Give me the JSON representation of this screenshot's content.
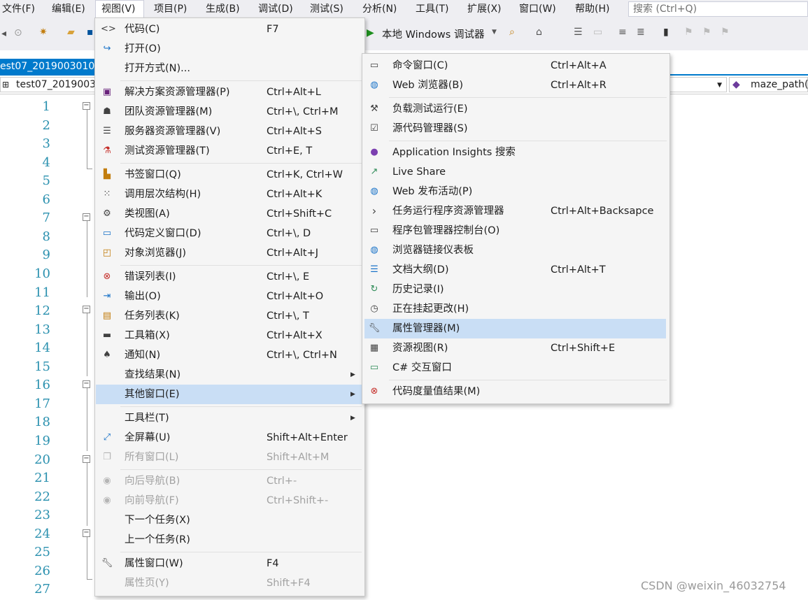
{
  "menubar": {
    "items": [
      "文件(F)",
      "编辑(E)",
      "视图(V)",
      "项目(P)",
      "生成(B)",
      "调试(D)",
      "测试(S)",
      "分析(N)",
      "工具(T)",
      "扩展(X)",
      "窗口(W)",
      "帮助(H)"
    ],
    "search_placeholder": "搜索 (Ctrl+Q)"
  },
  "toolbar": {
    "debugger_label": "本地 Windows 调试器"
  },
  "document": {
    "tab_title": "est07_2019003010",
    "nav_project": "test07_2019003",
    "nav_member": "maze_path("
  },
  "editor": {
    "line_numbers": [
      "1",
      "2",
      "3",
      "4",
      "5",
      "6",
      "7",
      "8",
      "9",
      "10",
      "11",
      "12",
      "13",
      "14",
      "15",
      "16",
      "17",
      "18",
      "19",
      "20",
      "21",
      "22",
      "23",
      "24",
      "25",
      "26",
      "27"
    ]
  },
  "view_menu": {
    "items": [
      {
        "label": "代码(C)",
        "shortcut": "F7",
        "icon": "code-icon"
      },
      {
        "label": "打开(O)",
        "shortcut": "",
        "icon": "open-icon"
      },
      {
        "label": "打开方式(N)...",
        "shortcut": "",
        "icon": ""
      },
      {
        "label": "解决方案资源管理器(P)",
        "shortcut": "Ctrl+Alt+L",
        "icon": "solution-explorer-icon"
      },
      {
        "label": "团队资源管理器(M)",
        "shortcut": "Ctrl+\\, Ctrl+M",
        "icon": "team-explorer-icon"
      },
      {
        "label": "服务器资源管理器(V)",
        "shortcut": "Ctrl+Alt+S",
        "icon": "server-explorer-icon"
      },
      {
        "label": "测试资源管理器(T)",
        "shortcut": "Ctrl+E, T",
        "icon": "test-explorer-icon"
      },
      {
        "label": "书签窗口(Q)",
        "shortcut": "Ctrl+K, Ctrl+W",
        "icon": "bookmark-window-icon"
      },
      {
        "label": "调用层次结构(H)",
        "shortcut": "Ctrl+Alt+K",
        "icon": "call-hierarchy-icon"
      },
      {
        "label": "类视图(A)",
        "shortcut": "Ctrl+Shift+C",
        "icon": "class-view-icon"
      },
      {
        "label": "代码定义窗口(D)",
        "shortcut": "Ctrl+\\, D",
        "icon": "code-definition-icon"
      },
      {
        "label": "对象浏览器(J)",
        "shortcut": "Ctrl+Alt+J",
        "icon": "object-browser-icon"
      },
      {
        "label": "错误列表(I)",
        "shortcut": "Ctrl+\\, E",
        "icon": "error-list-icon"
      },
      {
        "label": "输出(O)",
        "shortcut": "Ctrl+Alt+O",
        "icon": "output-icon"
      },
      {
        "label": "任务列表(K)",
        "shortcut": "Ctrl+\\, T",
        "icon": "task-list-icon"
      },
      {
        "label": "工具箱(X)",
        "shortcut": "Ctrl+Alt+X",
        "icon": "toolbox-icon"
      },
      {
        "label": "通知(N)",
        "shortcut": "Ctrl+\\, Ctrl+N",
        "icon": "bell-icon"
      },
      {
        "label": "查找结果(N)",
        "shortcut": "",
        "icon": ""
      },
      {
        "label": "其他窗口(E)",
        "shortcut": "",
        "icon": ""
      },
      {
        "label": "工具栏(T)",
        "shortcut": "",
        "icon": ""
      },
      {
        "label": "全屏幕(U)",
        "shortcut": "Shift+Alt+Enter",
        "icon": "fullscreen-icon"
      },
      {
        "label": "所有窗口(L)",
        "shortcut": "Shift+Alt+M",
        "icon": "all-windows-icon"
      },
      {
        "label": "向后导航(B)",
        "shortcut": "Ctrl+-",
        "icon": "back-icon"
      },
      {
        "label": "向前导航(F)",
        "shortcut": "Ctrl+Shift+-",
        "icon": "forward-icon"
      },
      {
        "label": "下一个任务(X)",
        "shortcut": "",
        "icon": ""
      },
      {
        "label": "上一个任务(R)",
        "shortcut": "",
        "icon": ""
      },
      {
        "label": "属性窗口(W)",
        "shortcut": "F4",
        "icon": "wrench-icon"
      },
      {
        "label": "属性页(Y)",
        "shortcut": "Shift+F4",
        "icon": ""
      }
    ]
  },
  "other_windows_menu": {
    "items": [
      {
        "label": "命令窗口(C)",
        "shortcut": "Ctrl+Alt+A",
        "icon": "command-window-icon"
      },
      {
        "label": "Web 浏览器(B)",
        "shortcut": "Ctrl+Alt+R",
        "icon": "web-browser-icon"
      },
      {
        "label": "负载测试运行(E)",
        "shortcut": "",
        "icon": "load-test-icon"
      },
      {
        "label": "源代码管理器(S)",
        "shortcut": "",
        "icon": "source-control-icon"
      },
      {
        "label": "Application Insights 搜索",
        "shortcut": "",
        "icon": "lightbulb-icon"
      },
      {
        "label": "Live Share",
        "shortcut": "",
        "icon": "live-share-icon"
      },
      {
        "label": "Web 发布活动(P)",
        "shortcut": "",
        "icon": "globe-icon"
      },
      {
        "label": "任务运行程序资源管理器",
        "shortcut": "Ctrl+Alt+Backsapce",
        "icon": "chevron-right-icon"
      },
      {
        "label": "程序包管理器控制台(O)",
        "shortcut": "",
        "icon": "console-icon"
      },
      {
        "label": "浏览器链接仪表板",
        "shortcut": "",
        "icon": "browser-link-icon"
      },
      {
        "label": "文档大纲(D)",
        "shortcut": "Ctrl+Alt+T",
        "icon": "document-outline-icon"
      },
      {
        "label": "历史记录(I)",
        "shortcut": "",
        "icon": "history-icon"
      },
      {
        "label": "正在挂起更改(H)",
        "shortcut": "",
        "icon": "clock-icon"
      },
      {
        "label": "属性管理器(M)",
        "shortcut": "",
        "icon": "wrench-icon"
      },
      {
        "label": "资源视图(R)",
        "shortcut": "Ctrl+Shift+E",
        "icon": "resource-view-icon"
      },
      {
        "label": "C# 交互窗口",
        "shortcut": "",
        "icon": "csharp-interactive-icon"
      },
      {
        "label": "代码度量值结果(M)",
        "shortcut": "",
        "icon": "code-metrics-icon"
      }
    ]
  },
  "watermark": "CSDN @weixin_46032754"
}
